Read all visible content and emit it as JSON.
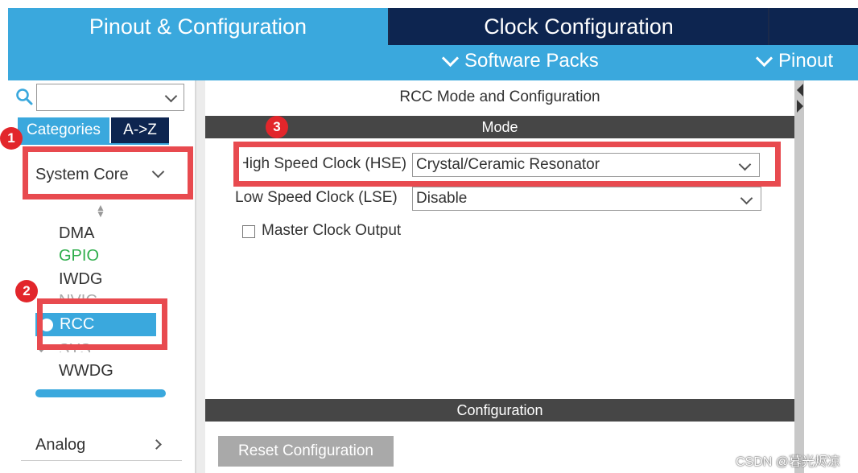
{
  "tabs": {
    "pinout_config": "Pinout & Configuration",
    "clock_config": "Clock Configuration"
  },
  "subbar": {
    "software_packs": "Software Packs",
    "pinout": "Pinout"
  },
  "sidebar": {
    "search_placeholder": "",
    "tab_categories": "Categories",
    "tab_az": "A->Z",
    "system_core": "System Core",
    "items": [
      {
        "label": "DMA"
      },
      {
        "label": "GPIO"
      },
      {
        "label": "IWDG"
      },
      {
        "label": "NVIC"
      },
      {
        "label": "RCC"
      },
      {
        "label": "SYS"
      },
      {
        "label": "WWDG"
      }
    ],
    "analog": "Analog"
  },
  "main": {
    "title": "RCC Mode and Configuration",
    "mode_header": "Mode",
    "hse_label": "High Speed Clock (HSE)",
    "hse_value": "Crystal/Ceramic Resonator",
    "lse_label": "Low Speed Clock (LSE)",
    "lse_value": "Disable",
    "mco_label": "Master Clock Output",
    "config_header": "Configuration",
    "reset_button": "Reset Configuration"
  },
  "annotations": {
    "badge1": "1",
    "badge2": "2",
    "badge3": "3"
  },
  "watermark": "CSDN @暮光烬凉",
  "colors": {
    "accent_blue": "#3aa8dd",
    "dark_navy": "#0d2550",
    "header_gray": "#464646",
    "annotation_red": "#e84a4f",
    "gpio_green": "#2fae4c"
  }
}
